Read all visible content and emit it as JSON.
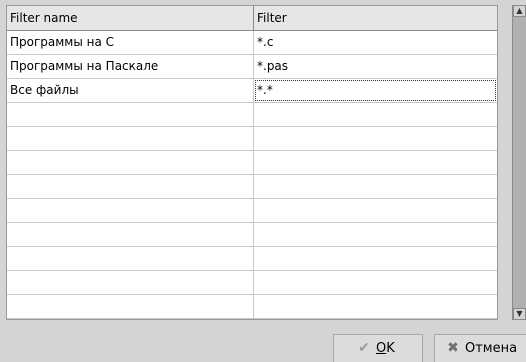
{
  "table": {
    "columns": [
      "Filter name",
      "Filter"
    ],
    "rows": [
      {
        "name": "Программы на C",
        "filter": "*.c"
      },
      {
        "name": "Программы на Паскале",
        "filter": "*.pas"
      },
      {
        "name": "Все файлы",
        "filter": "*.*"
      },
      {
        "name": "",
        "filter": ""
      },
      {
        "name": "",
        "filter": ""
      },
      {
        "name": "",
        "filter": ""
      },
      {
        "name": "",
        "filter": ""
      },
      {
        "name": "",
        "filter": ""
      },
      {
        "name": "",
        "filter": ""
      },
      {
        "name": "",
        "filter": ""
      },
      {
        "name": "",
        "filter": ""
      },
      {
        "name": "",
        "filter": ""
      }
    ]
  },
  "buttons": {
    "ok_label": "OK",
    "ok_mnemonic": "O",
    "ok_rest": "K",
    "ok_icon": "checkmark-icon",
    "cancel_label": "Отмена",
    "cancel_icon": "close-icon"
  }
}
